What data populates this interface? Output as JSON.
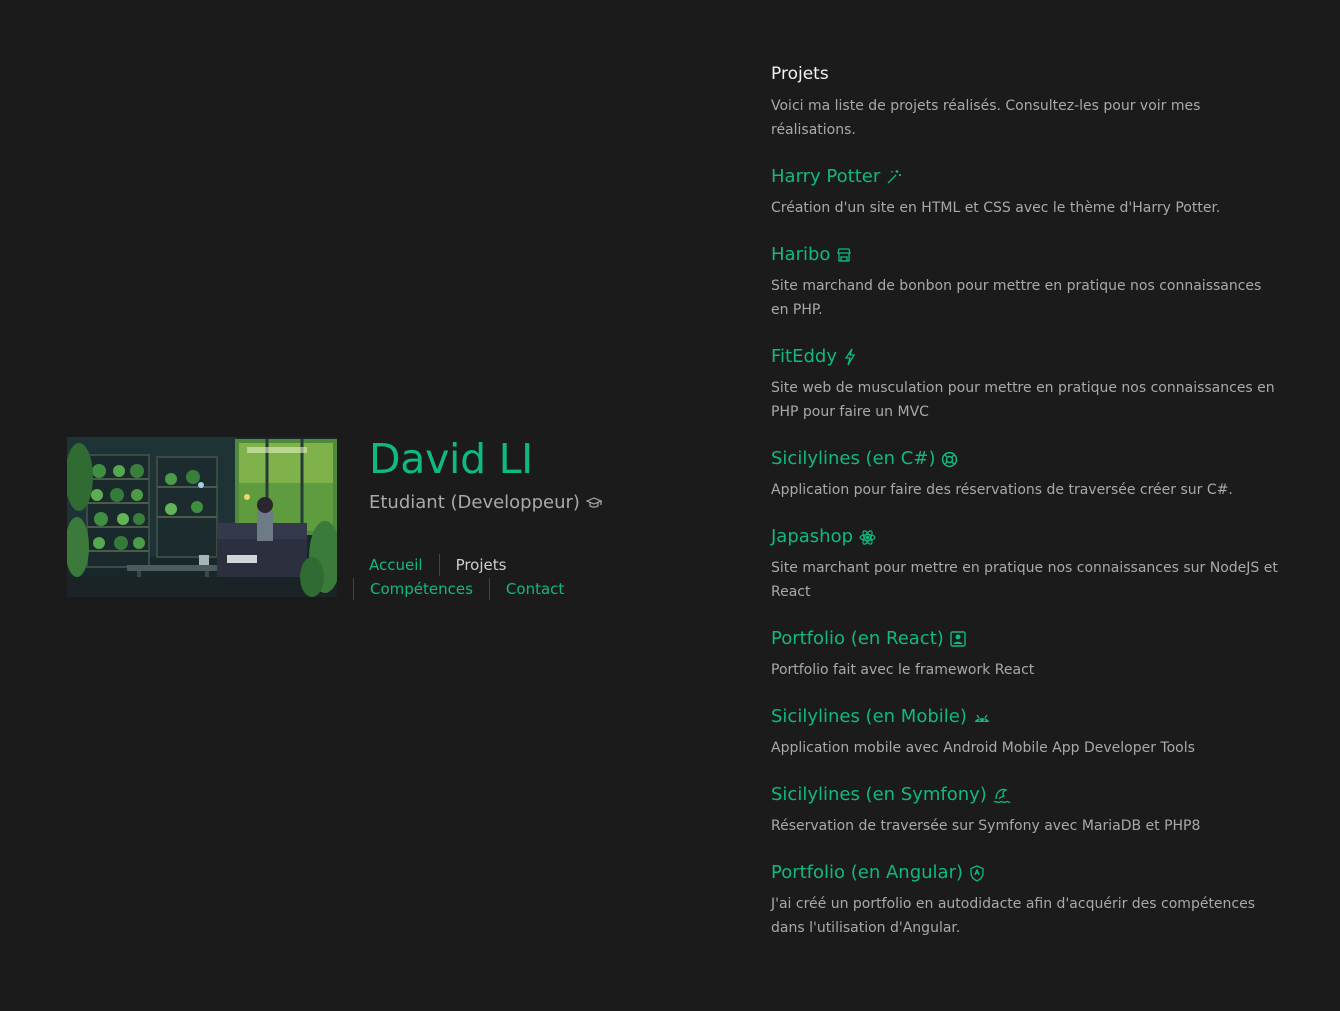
{
  "profile": {
    "name": "David LI",
    "role": "Etudiant (Developpeur)",
    "role_icon": "graduation-cap-icon"
  },
  "nav": {
    "home": "Accueil",
    "projects": "Projets",
    "skills": "Compétences",
    "contact": "Contact"
  },
  "projects": {
    "title": "Projets",
    "intro": "Voici ma liste de projets réalisés. Consultez-les pour voir mes réalisations.",
    "items": [
      {
        "title": "Harry Potter",
        "icon": "magic-wand-icon",
        "description": "Création d'un site en HTML et CSS avec le thème d'Harry Potter."
      },
      {
        "title": "Haribo",
        "icon": "storefront-icon",
        "description": "Site marchand de bonbon pour mettre en pratique nos connaissances en PHP."
      },
      {
        "title": "FitEddy",
        "icon": "lightning-icon",
        "description": "Site web de musculation pour mettre en pratique nos connaissances en PHP pour faire un MVC"
      },
      {
        "title": "Sicilylines (en C#)",
        "icon": "lifebuoy-icon",
        "description": "Application pour faire des réservations de traversée créer sur C#."
      },
      {
        "title": "Japashop",
        "icon": "react-atom-icon",
        "description": "Site marchant pour mettre en pratique nos connaissances sur NodeJS et React"
      },
      {
        "title": "Portfolio (en React)",
        "icon": "person-card-icon",
        "description": "Portfolio fait avec le framework React"
      },
      {
        "title": "Sicilylines (en Mobile)",
        "icon": "android-icon",
        "description": "Application mobile avec Android Mobile App Developer Tools"
      },
      {
        "title": "Sicilylines (en Symfony)",
        "icon": "wave-icon",
        "description": "Réservation de traversée sur Symfony avec MariaDB et PHP8"
      },
      {
        "title": "Portfolio (en Angular)",
        "icon": "shield-icon",
        "description": "J'ai créé un portfolio en autodidacte afin d'acquérir des compétences dans l'utilisation d'Angular."
      }
    ]
  },
  "colors": {
    "background": "#1b1b1b",
    "accent": "#10b981",
    "text_muted": "#a9a9a9",
    "text_light": "#f2f2f2"
  }
}
